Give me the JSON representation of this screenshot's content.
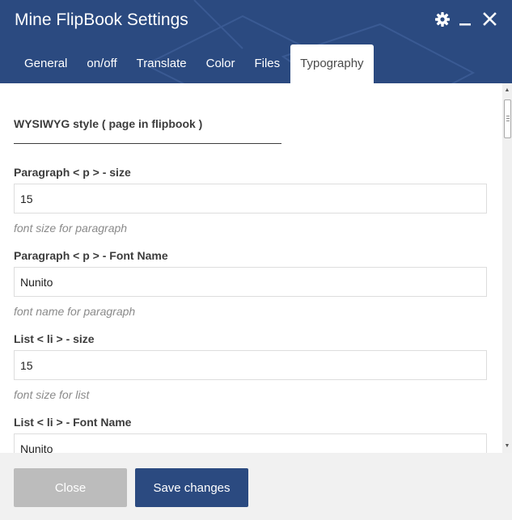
{
  "dialog": {
    "title": "Mine FlipBook Settings",
    "accent_color": "#2b4a80"
  },
  "header_icons": {
    "settings": "gear-icon",
    "minimize": "minimize-icon",
    "close": "close-icon"
  },
  "tabs": [
    {
      "label": "General"
    },
    {
      "label": "on/off"
    },
    {
      "label": "Translate"
    },
    {
      "label": "Color"
    },
    {
      "label": "Files"
    },
    {
      "label": "Typography",
      "active": true
    }
  ],
  "section": {
    "title": "WYSIWYG style ( page in flipbook )"
  },
  "fields": [
    {
      "label": "Paragraph < p > - size",
      "value": "15",
      "help": "font size for paragraph"
    },
    {
      "label": "Paragraph < p > - Font Name",
      "value": "Nunito",
      "help": "font name for paragraph"
    },
    {
      "label": "List < li > - size",
      "value": "15",
      "help": "font size for list"
    },
    {
      "label": "List < li > - Font Name",
      "value": "Nunito"
    }
  ],
  "footer": {
    "close_label": "Close",
    "save_label": "Save changes"
  }
}
